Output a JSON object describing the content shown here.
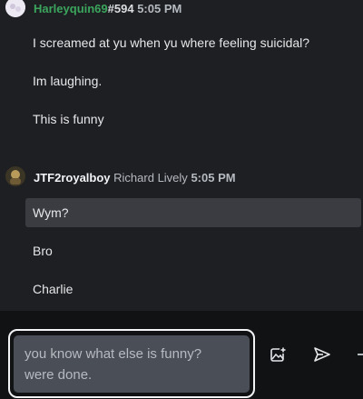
{
  "messages": [
    {
      "username": "Harleyquin69",
      "tag": "#594",
      "realname": "",
      "time": "5:05 PM",
      "username_color": "#3ba55d",
      "lines": [
        {
          "text": "I screamed at yu when yu where feeling suicidal?"
        },
        {
          "text": "Im laughing."
        },
        {
          "text": "This is funny"
        }
      ]
    },
    {
      "username": "JTF2royalboy",
      "tag": "",
      "realname": "Richard Lively",
      "time": "5:05 PM",
      "username_color": "#f2f3f5",
      "lines": [
        {
          "text": "Wym?",
          "highlighted": true
        },
        {
          "text": "Bro"
        },
        {
          "text": "Charlie"
        }
      ]
    }
  ],
  "composer": {
    "value": "you know what else is funny?\nwere done."
  },
  "icons": {
    "upload": "image-plus-icon",
    "send": "send-icon"
  }
}
